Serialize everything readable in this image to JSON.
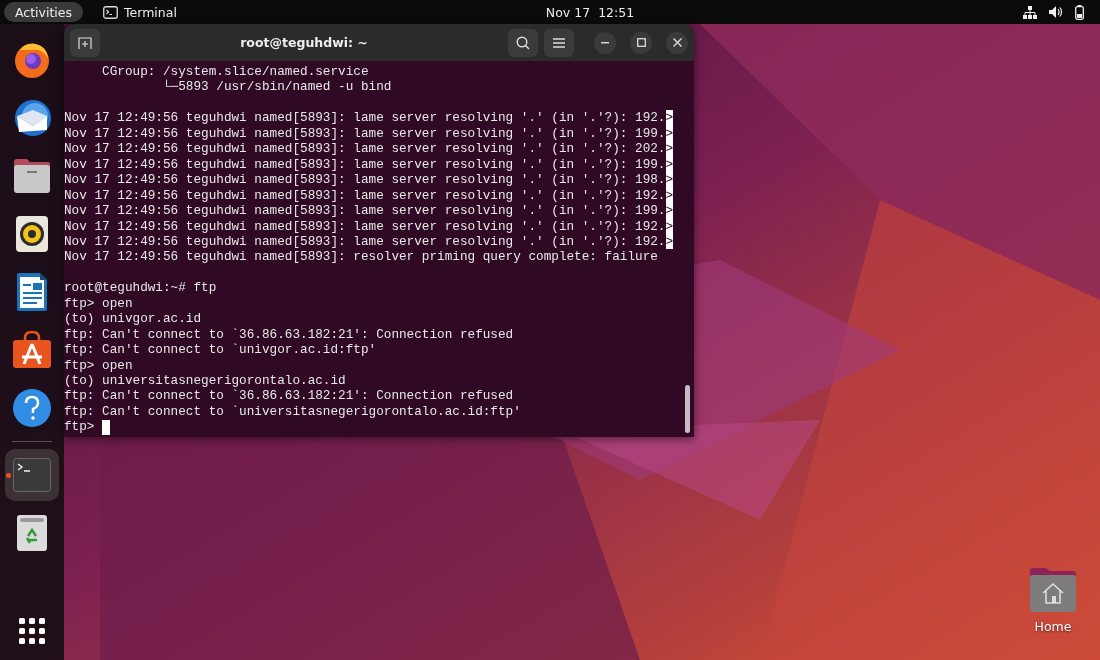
{
  "top_bar": {
    "activities": "Activities",
    "app_menu": "Terminal",
    "date": "Nov 17",
    "time": "12:51"
  },
  "dock": {
    "apps": [
      {
        "kind": "browser",
        "running": false
      },
      {
        "kind": "mail",
        "running": false
      },
      {
        "kind": "files",
        "running": false
      },
      {
        "kind": "music",
        "running": false
      },
      {
        "kind": "writer",
        "running": false
      },
      {
        "kind": "store",
        "running": false
      },
      {
        "kind": "help",
        "running": false
      },
      {
        "kind": "terminal",
        "running": true
      },
      {
        "kind": "trash",
        "running": false
      }
    ]
  },
  "window": {
    "title": "root@teguhdwi: ~"
  },
  "terminal": {
    "lines": [
      {
        "text": "     CGroup: /system.slice/named.service"
      },
      {
        "text": "             └─5893 /usr/sbin/named -u bind"
      },
      {
        "text": "Nov 17 12:49:56 teguhdwi named[5893]: lame server resolving '.' (in '.'?): 192.",
        "mark": ">",
        "blank_before": true
      },
      {
        "text": "Nov 17 12:49:56 teguhdwi named[5893]: lame server resolving '.' (in '.'?): 199.",
        "mark": ">"
      },
      {
        "text": "Nov 17 12:49:56 teguhdwi named[5893]: lame server resolving '.' (in '.'?): 202.",
        "mark": ">"
      },
      {
        "text": "Nov 17 12:49:56 teguhdwi named[5893]: lame server resolving '.' (in '.'?): 199.",
        "mark": ">"
      },
      {
        "text": "Nov 17 12:49:56 teguhdwi named[5893]: lame server resolving '.' (in '.'?): 198.",
        "mark": ">"
      },
      {
        "text": "Nov 17 12:49:56 teguhdwi named[5893]: lame server resolving '.' (in '.'?): 192.",
        "mark": ">"
      },
      {
        "text": "Nov 17 12:49:56 teguhdwi named[5893]: lame server resolving '.' (in '.'?): 199.",
        "mark": ">"
      },
      {
        "text": "Nov 17 12:49:56 teguhdwi named[5893]: lame server resolving '.' (in '.'?): 192.",
        "mark": ">"
      },
      {
        "text": "Nov 17 12:49:56 teguhdwi named[5893]: lame server resolving '.' (in '.'?): 192.",
        "mark": ">"
      },
      {
        "text": "Nov 17 12:49:56 teguhdwi named[5893]: resolver priming query complete: failure"
      },
      {
        "text": "root@teguhdwi:~# ftp",
        "blank_before": true
      },
      {
        "text": "ftp> open"
      },
      {
        "text": "(to) univgor.ac.id"
      },
      {
        "text": "ftp: Can't connect to `36.86.63.182:21': Connection refused"
      },
      {
        "text": "ftp: Can't connect to `univgor.ac.id:ftp'"
      },
      {
        "text": "ftp> open"
      },
      {
        "text": "(to) universitasnegerigorontalo.ac.id"
      },
      {
        "text": "ftp: Can't connect to `36.86.63.182:21': Connection refused"
      },
      {
        "text": "ftp: Can't connect to `universitasnegerigorontalo.ac.id:ftp'"
      },
      {
        "text": "ftp> ",
        "cursor": true
      }
    ]
  },
  "desktop": {
    "icons": [
      {
        "label": "Home"
      }
    ]
  }
}
